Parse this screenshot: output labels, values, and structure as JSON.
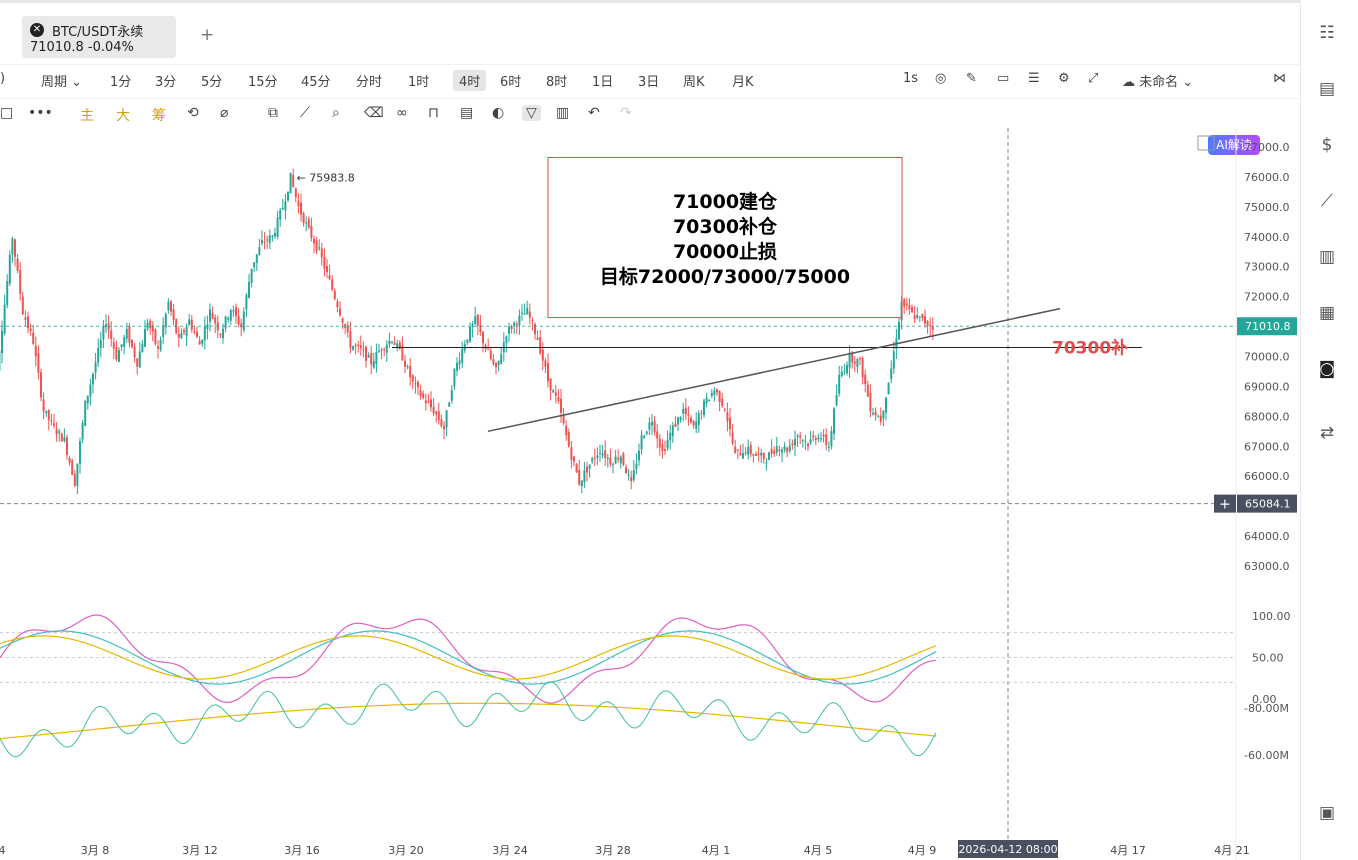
{
  "tab": {
    "name": "BTC/USDT永续",
    "price": "71010.8",
    "change": "-0.04%"
  },
  "periods": {
    "left_fragment": ")",
    "cycle_label": "周期",
    "items": [
      "1分",
      "3分",
      "5分",
      "15分",
      "45分",
      "分时",
      "1时",
      "4时",
      "6时",
      "8时",
      "1日",
      "3日",
      "周K",
      "月K"
    ],
    "active": "4时",
    "speed": "1s",
    "layout_name": "未命名",
    "ai_label": "AI解读"
  },
  "toolbar": {
    "indicator_labels": [
      "主",
      "大",
      "筹"
    ]
  },
  "chart_data": {
    "type": "candlestick",
    "symbol": "BTC/USDT永续",
    "interval": "4时",
    "y_ticks": [
      "77000.0",
      "76000.0",
      "75000.0",
      "74000.0",
      "73000.0",
      "72000.0",
      "71000.0",
      "70000.0",
      "69000.0",
      "68000.0",
      "67000.0",
      "66000.0",
      "65000.0",
      "64000.0",
      "63000.0"
    ],
    "ylim": [
      62700,
      77200
    ],
    "x_ticks": [
      "4",
      "3月 8",
      "3月 12",
      "3月 16",
      "3月 20",
      "3月 24",
      "3月 28",
      "4月 1",
      "4月 5",
      "4月 9",
      "4月 17",
      "4月 21"
    ],
    "price_path": [
      [
        -5,
        67500
      ],
      [
        0,
        71000
      ],
      [
        4,
        74000
      ],
      [
        8,
        71500
      ],
      [
        12,
        70500
      ],
      [
        16,
        68200
      ],
      [
        20,
        67600
      ],
      [
        24,
        67200
      ],
      [
        28,
        65800
      ],
      [
        32,
        68400
      ],
      [
        36,
        69800
      ],
      [
        40,
        71200
      ],
      [
        44,
        70000
      ],
      [
        48,
        70800
      ],
      [
        52,
        69800
      ],
      [
        56,
        71200
      ],
      [
        60,
        70200
      ],
      [
        64,
        71800
      ],
      [
        68,
        70500
      ],
      [
        72,
        71200
      ],
      [
        76,
        70400
      ],
      [
        80,
        71500
      ],
      [
        84,
        70800
      ],
      [
        88,
        71600
      ],
      [
        92,
        71000
      ],
      [
        96,
        73000
      ],
      [
        100,
        73800
      ],
      [
        104,
        74000
      ],
      [
        108,
        75000
      ],
      [
        111,
        75983.8
      ],
      [
        114,
        75000
      ],
      [
        118,
        74200
      ],
      [
        122,
        73500
      ],
      [
        126,
        72500
      ],
      [
        130,
        71500
      ],
      [
        134,
        70400
      ],
      [
        138,
        70200
      ],
      [
        142,
        69800
      ],
      [
        146,
        70300
      ],
      [
        150,
        70600
      ],
      [
        154,
        70000
      ],
      [
        158,
        69100
      ],
      [
        162,
        68600
      ],
      [
        166,
        68200
      ],
      [
        170,
        67600
      ],
      [
        174,
        69500
      ],
      [
        178,
        70500
      ],
      [
        182,
        71200
      ],
      [
        186,
        70300
      ],
      [
        190,
        69500
      ],
      [
        194,
        70800
      ],
      [
        198,
        71200
      ],
      [
        202,
        71500
      ],
      [
        206,
        70600
      ],
      [
        210,
        69200
      ],
      [
        214,
        68400
      ],
      [
        218,
        67000
      ],
      [
        222,
        65800
      ],
      [
        226,
        66400
      ],
      [
        230,
        66900
      ],
      [
        234,
        66500
      ],
      [
        238,
        66700
      ],
      [
        242,
        65700
      ],
      [
        246,
        67300
      ],
      [
        250,
        67900
      ],
      [
        254,
        66800
      ],
      [
        258,
        67600
      ],
      [
        262,
        68200
      ],
      [
        266,
        67600
      ],
      [
        270,
        68400
      ],
      [
        274,
        68900
      ],
      [
        278,
        68300
      ],
      [
        282,
        66700
      ],
      [
        286,
        66900
      ],
      [
        290,
        66700
      ],
      [
        294,
        66600
      ],
      [
        298,
        67000
      ],
      [
        302,
        66900
      ],
      [
        306,
        67400
      ],
      [
        310,
        67100
      ],
      [
        314,
        67400
      ],
      [
        318,
        67000
      ],
      [
        322,
        69300
      ],
      [
        326,
        70000
      ],
      [
        330,
        69800
      ],
      [
        334,
        68300
      ],
      [
        338,
        67900
      ],
      [
        342,
        69600
      ],
      [
        346,
        71800
      ],
      [
        350,
        71400
      ],
      [
        354,
        71200
      ],
      [
        358,
        71010.8
      ]
    ],
    "high_label": "75983.8",
    "current_price": "71010.8",
    "crosshair_price": "65084.1",
    "crosshair_time": "2026-04-12 08:00",
    "lines": {
      "horizontal": 70300,
      "horizontal_label": "70300补"
    },
    "annotation_lines": [
      "71000建仓",
      "70300补仓",
      "70000止损",
      "目标72000/73000/75000"
    ],
    "oscillator_ticks": [
      "100.00",
      "50.00",
      "0.00"
    ],
    "volume_ticks": [
      "-60.00M",
      "-80.00M"
    ]
  },
  "sidebar_icons": [
    "layout-icon",
    "document-icon",
    "dollar-doc-icon",
    "chart-line-icon",
    "chart-bars-icon",
    "stack-icon",
    "robot-icon",
    "exchange-icon",
    "panel-icon"
  ],
  "colors": {
    "up": "#26a69a",
    "down": "#ef5350",
    "accent_gold": "#d4a017",
    "annotation_box": "#e24b4b",
    "label_red": "#e24b4b"
  }
}
